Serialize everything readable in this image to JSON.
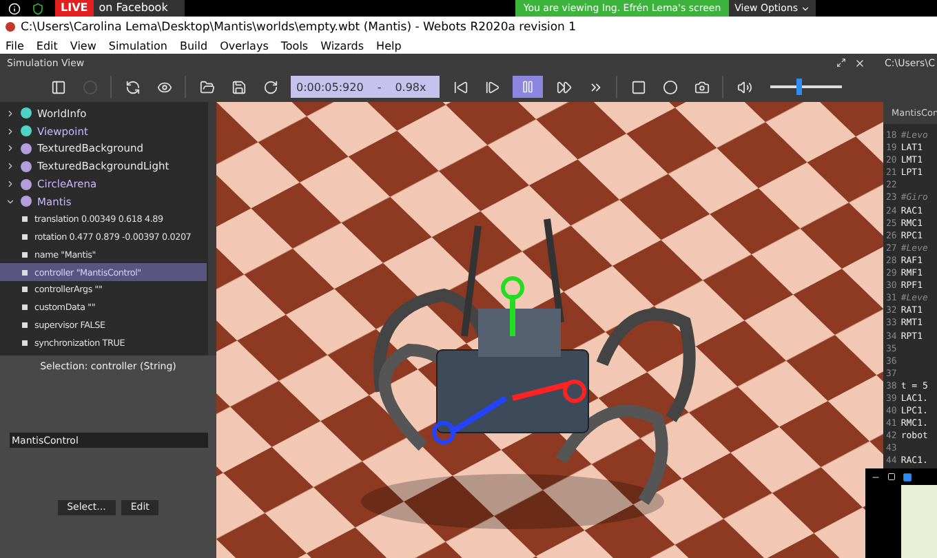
{
  "meeting_bar": {
    "live_badge": "LIVE",
    "live_text": "on Facebook",
    "viewing_notice": "You are viewing Ing. Efrén Lema's screen",
    "view_options": "View Options"
  },
  "window": {
    "title": "C:\\Users\\Carolina Lema\\Desktop\\Mantis\\worlds\\empty.wbt (Mantis) - Webots R2020a revision 1"
  },
  "menu": [
    "File",
    "Edit",
    "View",
    "Simulation",
    "Build",
    "Overlays",
    "Tools",
    "Wizards",
    "Help"
  ],
  "dock": {
    "title": "Simulation View",
    "editor_path": "C:\\Users\\C"
  },
  "toolbar": {
    "time": "0:00:05:920",
    "separator": "-",
    "speed": "0.98x",
    "paused": true,
    "volume": {
      "level": 0.4
    }
  },
  "scene_tree": [
    {
      "label": "WorldInfo",
      "color": "#4fd1c5",
      "expanded": false,
      "highlight": false
    },
    {
      "label": "Viewpoint",
      "color": "#4fd1c5",
      "expanded": false,
      "highlight": true
    },
    {
      "label": "TexturedBackground",
      "color": "#b39ddb",
      "expanded": false,
      "highlight": false
    },
    {
      "label": "TexturedBackgroundLight",
      "color": "#b39ddb",
      "expanded": false,
      "highlight": false
    },
    {
      "label": "CircleArena",
      "color": "#b39ddb",
      "expanded": false,
      "highlight": true
    },
    {
      "label": "Mantis",
      "color": "#b39ddb",
      "expanded": true,
      "highlight": true,
      "children": [
        {
          "label": "translation 0.00349 0.618 4.89",
          "selected": false
        },
        {
          "label": "rotation 0.477 0.879 -0.00397 0.0207",
          "selected": false
        },
        {
          "label": "name \"Mantis\"",
          "selected": false
        },
        {
          "label": "controller \"MantisControl\"",
          "selected": true
        },
        {
          "label": "controllerArgs \"\"",
          "selected": false
        },
        {
          "label": "customData \"\"",
          "selected": false
        },
        {
          "label": "supervisor FALSE",
          "selected": false
        },
        {
          "label": "synchronization TRUE",
          "selected": false
        }
      ]
    }
  ],
  "field_editor": {
    "selection": "Selection: controller (String)",
    "value": "MantisControl",
    "buttons": [
      "Select...",
      "Edit"
    ]
  },
  "editor": {
    "tab": "MantisCon",
    "lines": [
      {
        "number": "18",
        "kind": "comment",
        "code": "#Levo"
      },
      {
        "number": "19",
        "kind": "code",
        "code": "LAT1"
      },
      {
        "number": "20",
        "kind": "code",
        "code": "LMT1"
      },
      {
        "number": "21",
        "kind": "code",
        "code": "LPT1"
      },
      {
        "number": "22"
      },
      {
        "number": "23",
        "kind": "comment",
        "code": "#Giro"
      },
      {
        "number": "24",
        "kind": "code",
        "code": "RAC1"
      },
      {
        "number": "25",
        "kind": "code",
        "code": "RMC1"
      },
      {
        "number": "26",
        "kind": "code",
        "code": "RPC1"
      },
      {
        "number": "27",
        "kind": "comment",
        "code": "#Leve"
      },
      {
        "number": "28",
        "kind": "code",
        "code": "RAF1"
      },
      {
        "number": "29",
        "kind": "code",
        "code": "RMF1"
      },
      {
        "number": "30",
        "kind": "code",
        "code": "RPF1"
      },
      {
        "number": "31",
        "kind": "comment",
        "code": "#Leve"
      },
      {
        "number": "32",
        "kind": "code",
        "code": "RAT1"
      },
      {
        "number": "33",
        "kind": "code",
        "code": "RMT1"
      },
      {
        "number": "34",
        "kind": "code",
        "code": "RPT1"
      },
      {
        "number": "35"
      },
      {
        "number": "36"
      },
      {
        "number": "37"
      },
      {
        "number": "38",
        "kind": "code",
        "code": "t = 5"
      },
      {
        "number": "39",
        "kind": "code",
        "code": "LAC1."
      },
      {
        "number": "40",
        "kind": "code",
        "code": "LPC1."
      },
      {
        "number": "41",
        "kind": "code",
        "code": "RMC1."
      },
      {
        "number": "42",
        "kind": "code",
        "code": "robot"
      },
      {
        "number": "43"
      },
      {
        "number": "44",
        "kind": "code",
        "code": "RAC1."
      }
    ]
  }
}
